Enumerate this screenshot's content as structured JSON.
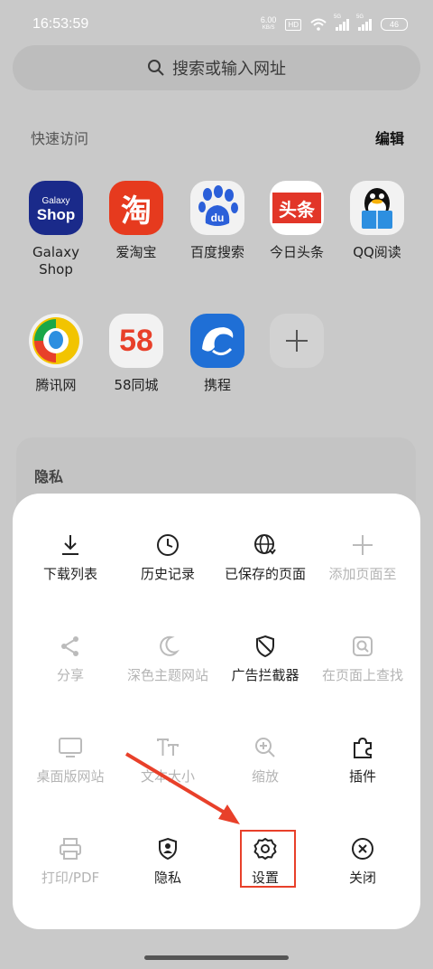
{
  "status": {
    "time": "16:53:59",
    "net_speed_value": "6.00",
    "net_speed_unit": "KB/S",
    "hd": "HD",
    "sig1": "5G",
    "sig2": "5G",
    "battery": "46"
  },
  "search": {
    "placeholder": "搜索或输入网址"
  },
  "quick_access": {
    "title": "快速访问",
    "edit": "编辑",
    "items": [
      {
        "label": "Galaxy\nShop",
        "icon": "galaxy-shop-icon",
        "icon_text": "Galaxy\nShop"
      },
      {
        "label": "爱淘宝",
        "icon": "taobao-icon",
        "icon_text": "淘"
      },
      {
        "label": "百度搜索",
        "icon": "baidu-icon",
        "icon_text": "du"
      },
      {
        "label": "今日头条",
        "icon": "toutiao-icon",
        "icon_text": "头条"
      },
      {
        "label": "QQ阅读",
        "icon": "qq-reader-icon"
      },
      {
        "label": "腾讯网",
        "icon": "tencent-icon"
      },
      {
        "label": "58同城",
        "icon": "58-icon",
        "icon_text": "58"
      },
      {
        "label": "携程",
        "icon": "ctrip-icon"
      },
      {
        "label": "",
        "icon": "add-icon"
      }
    ]
  },
  "privacy_card": {
    "title": "隐私"
  },
  "menu": {
    "items": [
      {
        "label": "下载列表",
        "icon": "download-icon",
        "enabled": true
      },
      {
        "label": "历史记录",
        "icon": "history-icon",
        "enabled": true
      },
      {
        "label": "已保存的页面",
        "icon": "saved-pages-icon",
        "enabled": true
      },
      {
        "label": "添加页面至",
        "icon": "plus-icon",
        "enabled": false
      },
      {
        "label": "分享",
        "icon": "share-icon",
        "enabled": false
      },
      {
        "label": "深色主题网站",
        "icon": "moon-icon",
        "enabled": false
      },
      {
        "label": "广告拦截器",
        "icon": "shield-icon",
        "enabled": true
      },
      {
        "label": "在页面上查找",
        "icon": "find-in-page-icon",
        "enabled": false
      },
      {
        "label": "桌面版网站",
        "icon": "desktop-icon",
        "enabled": false
      },
      {
        "label": "文本大小",
        "icon": "text-size-icon",
        "enabled": false
      },
      {
        "label": "缩放",
        "icon": "zoom-icon",
        "enabled": false
      },
      {
        "label": "插件",
        "icon": "puzzle-icon",
        "enabled": true
      },
      {
        "label": "打印/PDF",
        "icon": "print-icon",
        "enabled": false
      },
      {
        "label": "隐私",
        "icon": "privacy-icon",
        "enabled": true
      },
      {
        "label": "设置",
        "icon": "gear-icon",
        "enabled": true
      },
      {
        "label": "关闭",
        "icon": "close-icon",
        "enabled": true
      }
    ]
  },
  "colors": {
    "annotation_red": "#e8402a",
    "dim_overlay": "#c9c9c9"
  }
}
